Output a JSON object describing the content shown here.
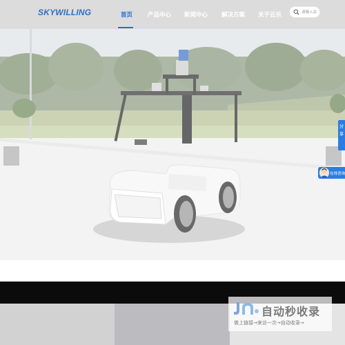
{
  "header": {
    "logo": "SKYWILLING",
    "nav": [
      {
        "label": "首页",
        "active": true
      },
      {
        "label": "产品中心",
        "active": false
      },
      {
        "label": "新闻中心",
        "active": false
      },
      {
        "label": "解决方案",
        "active": false
      },
      {
        "label": "关于云乐",
        "active": false
      }
    ],
    "search": {
      "placeholder": "请输入关"
    }
  },
  "hero": {
    "icons": {
      "prev": "chevron-left-icon",
      "next": "chevron-right-icon"
    }
  },
  "side": {
    "share_label": "分享",
    "consult_label": "在线咨询"
  },
  "watermark": {
    "title": "自动秒收录",
    "subtitle": "做上链接→来访一次→自动收录→"
  },
  "colors": {
    "brand_blue": "#2a6fcf",
    "header_bg": "#dcdcdc",
    "widget_blue": "#2a7de1",
    "dark_band": "#0b0b0b"
  }
}
